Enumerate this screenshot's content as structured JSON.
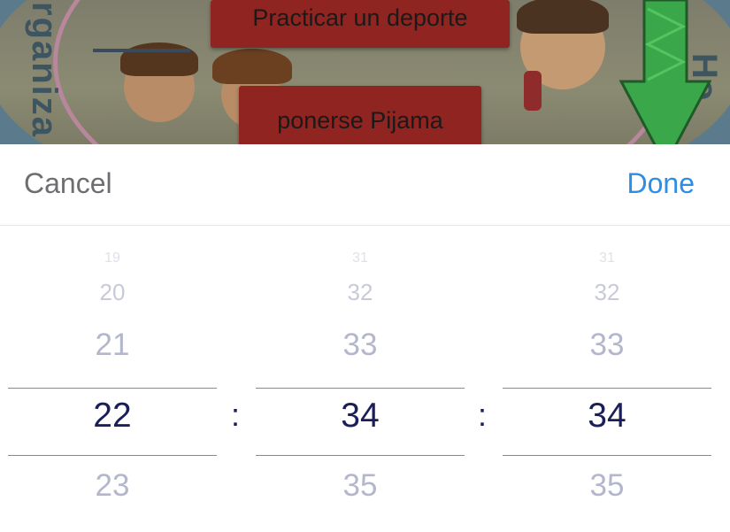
{
  "background": {
    "button_top": "Practicar un deporte",
    "button_bottom": "ponerse Pijama",
    "ring_text_left": "rganiza",
    "ring_text_right": "Ho",
    "arrow_color": "#3aa84a"
  },
  "toolbar": {
    "cancel_label": "Cancel",
    "done_label": "Done"
  },
  "picker": {
    "separator": ":",
    "wheels": [
      {
        "far": "19",
        "prev2": "20",
        "prev": "21",
        "selected": "22",
        "next": "23"
      },
      {
        "far": "31",
        "prev2": "32",
        "prev": "33",
        "selected": "34",
        "next": "35"
      },
      {
        "far": "31",
        "prev2": "32",
        "prev": "33",
        "selected": "34",
        "next": "35"
      }
    ]
  },
  "colors": {
    "done": "#2d8ee3",
    "cancel": "#6d6d72",
    "selected_value": "#1a1f5a",
    "dim_value": "#b4b7cc"
  }
}
